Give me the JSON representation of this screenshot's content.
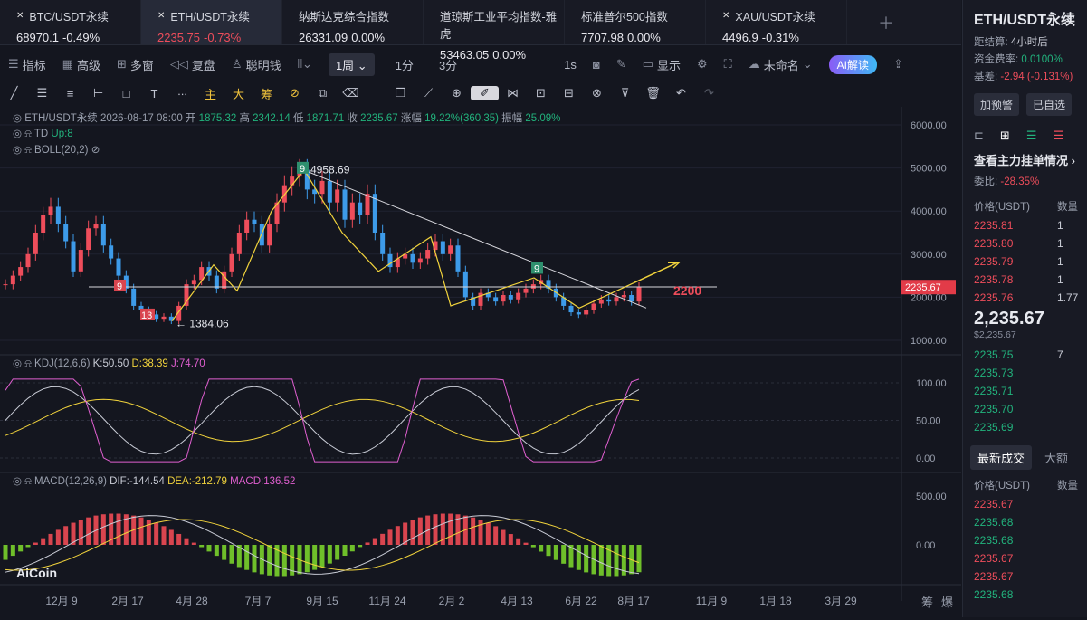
{
  "tickers": [
    {
      "name": "BTC/USDT永续",
      "price": "68970.1",
      "change": "-0.49%",
      "active": false,
      "pc": "#e8e8ee",
      "cc": "#e8e8ee",
      "x": true
    },
    {
      "name": "ETH/USDT永续",
      "price": "2235.75",
      "change": "-0.73%",
      "active": true,
      "pc": "#ee4d5b",
      "cc": "#ee4d5b",
      "x": true
    },
    {
      "name": "纳斯达克综合指数",
      "price": "26331.09",
      "change": "0.00%",
      "active": false,
      "pc": "#e8e8ee",
      "cc": "#e8e8ee",
      "x": false
    },
    {
      "name": "道琼斯工业平均指数-雅虎",
      "price": "53463.05",
      "change": "0.00%",
      "active": false,
      "pc": "#e8e8ee",
      "cc": "#e8e8ee",
      "x": false
    },
    {
      "name": "标准普尔500指数",
      "price": "7707.98",
      "change": "0.00%",
      "active": false,
      "pc": "#e8e8ee",
      "cc": "#e8e8ee",
      "x": false
    },
    {
      "name": "XAU/USDT永续",
      "price": "4496.9",
      "change": "-0.31%",
      "active": false,
      "pc": "#e8e8ee",
      "cc": "#e8e8ee",
      "x": true
    }
  ],
  "toolbar": {
    "indicators": "指标",
    "advanced": "高级",
    "multi": "多窗",
    "replay": "复盘",
    "smart": "聪明钱",
    "period": "1周",
    "p1": "1分",
    "p3": "3分",
    "sec": "1s",
    "display": "显示",
    "unnamed": "未命名",
    "ai": "AI解读"
  },
  "drawtools": {
    "zhu": "主",
    "da": "大",
    "chou": "筹"
  },
  "chart": {
    "symbol": "ETH/USDT永续",
    "date": "2026-08-17 08:00",
    "o_l": "开",
    "o": "1875.32",
    "h_l": "高",
    "h": "2342.14",
    "l_l": "低",
    "l": "1871.71",
    "c_l": "收",
    "c": "2235.67",
    "chg_l": "涨幅",
    "chg": "19.22%(360.35)",
    "amp_l": "振幅",
    "amp": "25.09%",
    "td": "TD",
    "td_up": "Up:8",
    "boll": "BOLL(20,2)",
    "kdj": "KDJ(12,6,6)",
    "k": "K:50.50",
    "d": "D:38.39",
    "j": "J:74.70",
    "macd": "MACD(12,26,9)",
    "dif": "DIF:-144.54",
    "dea": "DEA:-212.79",
    "macdv": "MACD:136.52",
    "last": "2235.67",
    "hi_label": "4958.69",
    "lo_label": "← 1384.06",
    "target": "2200",
    "td9a": "9",
    "td9b": "9",
    "td9c": "9",
    "td13": "13",
    "yaxis": [
      "6000.00",
      "5000.00",
      "4000.00",
      "3000.00",
      "2000.00",
      "1000.00"
    ],
    "kdj_axis": [
      "100.00",
      "50.00",
      "0.00"
    ],
    "macd_axis": [
      "500.00",
      "0.00"
    ],
    "xaxis": [
      "12月 9",
      "2月 17",
      "4月 28",
      "7月 7",
      "9月 15",
      "11月 24",
      "2月 2",
      "4月 13",
      "6月 22",
      "8月 17",
      "11月 9",
      "1月 18",
      "3月 29"
    ],
    "logo": "AiCoin",
    "corner1": "筹",
    "corner2": "爆"
  },
  "sidebar": {
    "title": "ETH/USDT永续",
    "settle_l": "距结算:",
    "settle": "4小时后",
    "fund_l": "资金费率:",
    "fund": "0.0100%",
    "basis_l": "基差:",
    "basis": "-2.94 (-0.131%)",
    "alert": "加预警",
    "fav": "已自选",
    "book_title": "查看主力挂单情况",
    "ratio_l": "委比:",
    "ratio": "-28.35%",
    "col_price": "价格(USDT)",
    "col_qty": "数量",
    "asks": [
      {
        "p": "2235.81",
        "q": "1"
      },
      {
        "p": "2235.80",
        "q": "1"
      },
      {
        "p": "2235.79",
        "q": "1"
      },
      {
        "p": "2235.78",
        "q": "1"
      },
      {
        "p": "2235.76",
        "q": "1.77"
      }
    ],
    "mid": "2,235.67",
    "mid_usd": "$2,235.67",
    "bids": [
      {
        "p": "2235.75",
        "q": "7"
      },
      {
        "p": "2235.73",
        "q": ""
      },
      {
        "p": "2235.71",
        "q": ""
      },
      {
        "p": "2235.70",
        "q": ""
      },
      {
        "p": "2235.69",
        "q": ""
      }
    ],
    "tab_trades": "最新成交",
    "tab_big": "大额",
    "trades": [
      {
        "p": "2235.67",
        "c": "#ee4d5b"
      },
      {
        "p": "2235.68",
        "c": "#22b37d"
      },
      {
        "p": "2235.68",
        "c": "#22b37d"
      },
      {
        "p": "2235.67",
        "c": "#ee4d5b"
      },
      {
        "p": "2235.67",
        "c": "#ee4d5b"
      },
      {
        "p": "2235.68",
        "c": "#22b37d"
      }
    ]
  }
}
